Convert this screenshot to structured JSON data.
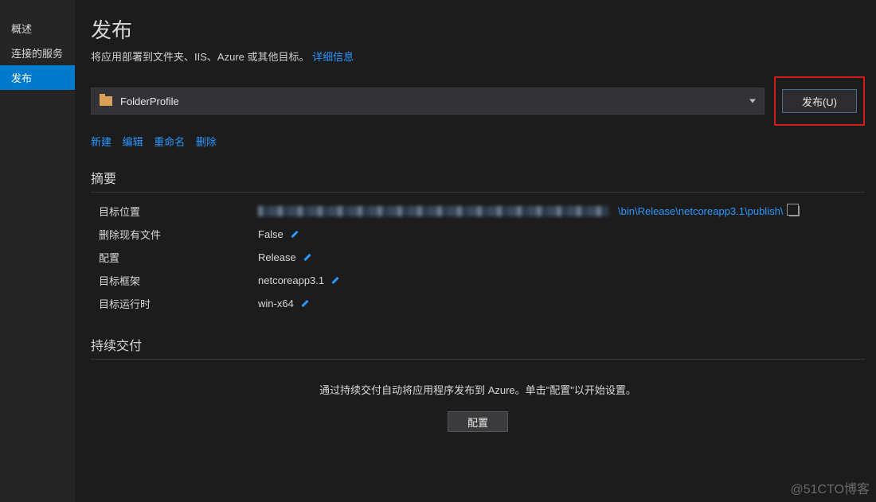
{
  "sidebar": {
    "items": [
      {
        "label": "概述"
      },
      {
        "label": "连接的服务"
      },
      {
        "label": "发布"
      }
    ]
  },
  "header": {
    "title": "发布",
    "description": "将应用部署到文件夹、IIS、Azure 或其他目标。",
    "details_link": "详细信息"
  },
  "profile": {
    "selected": "FolderProfile",
    "publish_button": "发布(U)"
  },
  "actions": {
    "new": "新建",
    "edit": "编辑",
    "rename": "重命名",
    "delete": "删除"
  },
  "summary": {
    "title": "摘要",
    "rows": {
      "target_location": {
        "label": "目标位置",
        "value": "\\bin\\Release\\netcoreapp3.1\\publish\\"
      },
      "delete_existing": {
        "label": "删除现有文件",
        "value": "False"
      },
      "configuration": {
        "label": "配置",
        "value": "Release"
      },
      "target_framework": {
        "label": "目标框架",
        "value": "netcoreapp3.1"
      },
      "target_runtime": {
        "label": "目标运行时",
        "value": "win-x64"
      }
    }
  },
  "continuous_delivery": {
    "title": "持续交付",
    "description": "通过持续交付自动将应用程序发布到 Azure。单击\"配置\"以开始设置。",
    "configure_button": "配置"
  },
  "watermark": "@51CTO博客"
}
